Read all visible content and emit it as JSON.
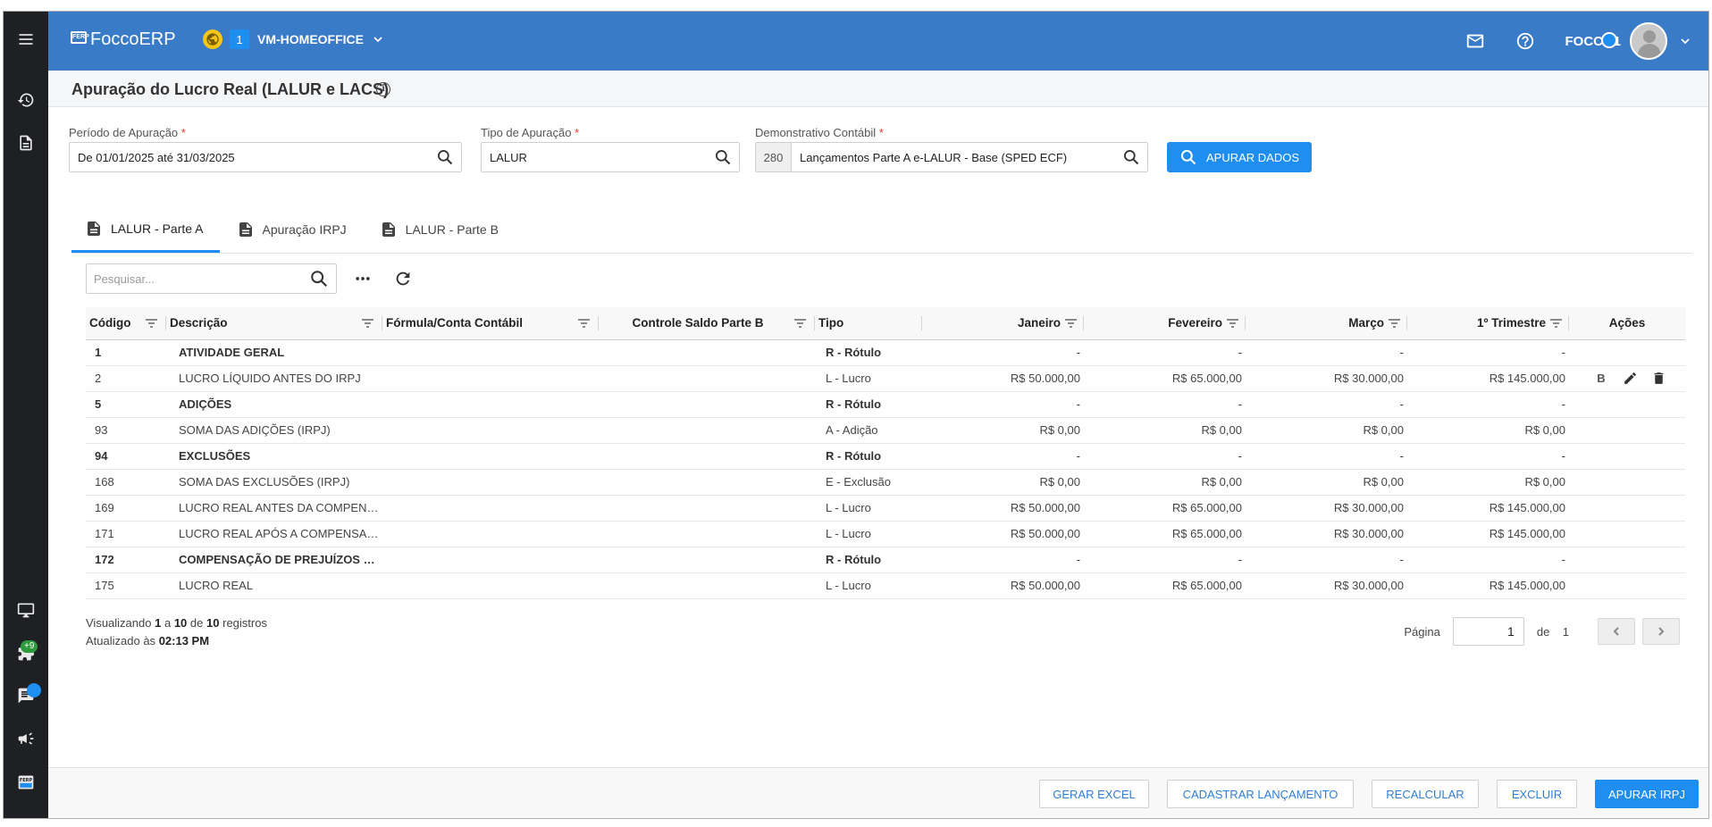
{
  "app": {
    "logo_text": "FoccoERP",
    "logo_badge": "FERP",
    "env_number": "1",
    "env_name": "VM-HOMEOFFICE",
    "user_name": "FOCCO1",
    "accent_color": "#3a7bc8",
    "button_color": "#1f8ef1"
  },
  "sidebar": {
    "items": [
      {
        "icon": "menu-icon"
      },
      {
        "icon": "history-icon"
      },
      {
        "icon": "document-icon"
      },
      {
        "icon": "monitor-icon"
      },
      {
        "icon": "puzzle-icon",
        "badge": "+9"
      },
      {
        "icon": "chat-icon"
      },
      {
        "icon": "megaphone-icon"
      },
      {
        "icon": "ferp-logo-icon"
      }
    ]
  },
  "page": {
    "title": "Apuração do Lucro Real (LALUR e LACS)"
  },
  "filters": {
    "periodo_label": "Período de Apuração",
    "periodo_value": "De 01/01/2025 até 31/03/2025",
    "tipo_label": "Tipo de Apuração",
    "tipo_value": "LALUR",
    "demonstrativo_label": "Demonstrativo Contábil",
    "demonstrativo_code": "280",
    "demonstrativo_value": "Lançamentos Parte A e-LALUR - Base (SPED ECF)",
    "required_mark": "*",
    "apurar_label": "APURAR DADOS"
  },
  "tabs": [
    {
      "label": "LALUR - Parte A",
      "active": true
    },
    {
      "label": "Apuração IRPJ",
      "active": false
    },
    {
      "label": "LALUR - Parte B",
      "active": false
    }
  ],
  "toolbar": {
    "search_placeholder": "Pesquisar..."
  },
  "table": {
    "headers": [
      "Código",
      "Descrição",
      "Fórmula/Conta Contábil",
      "Controle Saldo Parte B",
      "Tipo",
      "Janeiro",
      "Fevereiro",
      "Março",
      "1º Trimestre",
      "Ações"
    ],
    "rows": [
      {
        "codigo": "1",
        "descricao": "ATIVIDADE GERAL",
        "formula": "",
        "controle": "",
        "tipo": "R - Rótulo",
        "jan": "-",
        "fev": "-",
        "mar": "-",
        "tri": "-",
        "bold": true
      },
      {
        "codigo": "2",
        "descricao": "LUCRO LÍQUIDO ANTES DO IRPJ",
        "formula": "",
        "controle": "",
        "tipo": "L - Lucro",
        "jan": "R$ 50.000,00",
        "fev": "R$ 65.000,00",
        "mar": "R$ 30.000,00",
        "tri": "R$ 145.000,00",
        "bold": false,
        "actions": true
      },
      {
        "codigo": "5",
        "descricao": "ADIÇÕES",
        "formula": "",
        "controle": "",
        "tipo": "R - Rótulo",
        "jan": "-",
        "fev": "-",
        "mar": "-",
        "tri": "-",
        "bold": true
      },
      {
        "codigo": "93",
        "descricao": "SOMA DAS ADIÇÕES (IRPJ)",
        "formula": "",
        "controle": "",
        "tipo": "A - Adição",
        "jan": "R$ 0,00",
        "fev": "R$ 0,00",
        "mar": "R$ 0,00",
        "tri": "R$ 0,00",
        "bold": false
      },
      {
        "codigo": "94",
        "descricao": "EXCLUSÕES",
        "formula": "",
        "controle": "",
        "tipo": "R - Rótulo",
        "jan": "-",
        "fev": "-",
        "mar": "-",
        "tri": "-",
        "bold": true
      },
      {
        "codigo": "168",
        "descricao": "SOMA DAS EXCLUSÕES (IRPJ)",
        "formula": "",
        "controle": "",
        "tipo": "E - Exclusão",
        "jan": "R$ 0,00",
        "fev": "R$ 0,00",
        "mar": "R$ 0,00",
        "tri": "R$ 0,00",
        "bold": false
      },
      {
        "codigo": "169",
        "descricao": "LUCRO REAL ANTES DA COMPEN…",
        "formula": "",
        "controle": "",
        "tipo": "L - Lucro",
        "jan": "R$ 50.000,00",
        "fev": "R$ 65.000,00",
        "mar": "R$ 30.000,00",
        "tri": "R$ 145.000,00",
        "bold": false
      },
      {
        "codigo": "171",
        "descricao": "LUCRO REAL APÓS A COMPENSA…",
        "formula": "",
        "controle": "",
        "tipo": "L - Lucro",
        "jan": "R$ 50.000,00",
        "fev": "R$ 65.000,00",
        "mar": "R$ 30.000,00",
        "tri": "R$ 145.000,00",
        "bold": false
      },
      {
        "codigo": "172",
        "descricao": "COMPENSAÇÃO DE PREJUÍZOS F…",
        "formula": "",
        "controle": "",
        "tipo": "R - Rótulo",
        "jan": "-",
        "fev": "-",
        "mar": "-",
        "tri": "-",
        "bold": true
      },
      {
        "codigo": "175",
        "descricao": "LUCRO REAL",
        "formula": "",
        "controle": "",
        "tipo": "L - Lucro",
        "jan": "R$ 50.000,00",
        "fev": "R$ 65.000,00",
        "mar": "R$ 30.000,00",
        "tri": "R$ 145.000,00",
        "bold": false
      }
    ],
    "row_action_b": "B"
  },
  "footer": {
    "viewing_prefix": "Visualizando",
    "from": "1",
    "a": "a",
    "to": "10",
    "de": "de",
    "total": "10",
    "registros": "registros",
    "updated_prefix": "Atualizado às",
    "updated_time": "02:13 PM",
    "page_label": "Página",
    "page_current": "1",
    "page_of": "de",
    "page_total": "1"
  },
  "actions": {
    "gerar_excel": "GERAR EXCEL",
    "cadastrar": "CADASTRAR LANÇAMENTO",
    "recalcular": "RECALCULAR",
    "excluir": "EXCLUIR",
    "apurar_irpj": "APURAR IRPJ"
  }
}
